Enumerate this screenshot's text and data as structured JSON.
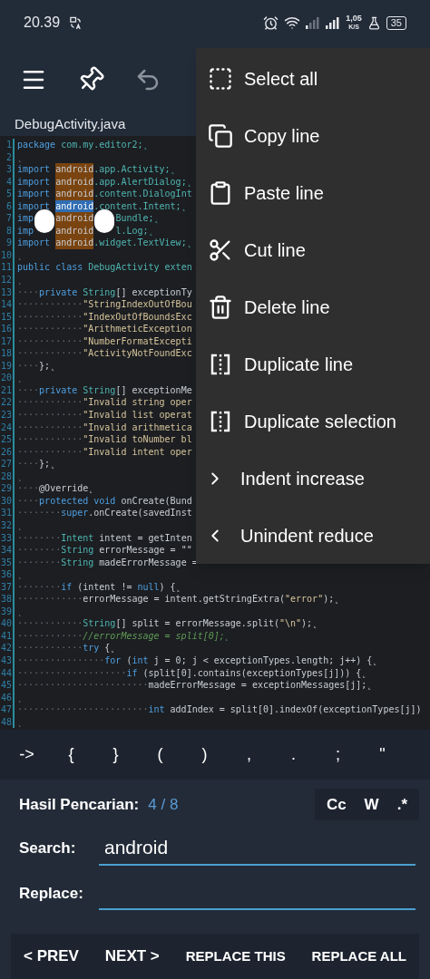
{
  "status_bar": {
    "time": "20.39",
    "speed_value": "1,05",
    "speed_unit": "K/S",
    "battery": "35"
  },
  "toolbar": [
    {
      "kind": "menu",
      "disabled": false
    },
    {
      "kind": "pin",
      "disabled": false
    },
    {
      "kind": "undo",
      "disabled": true
    }
  ],
  "file_tab": {
    "title": "DebugActivity.java"
  },
  "editor": {
    "lines": [
      {
        "number": "1",
        "segments": [
          {
            "text": "package",
            "kind": "kw"
          },
          {
            "text": " com.my.editor2;˛",
            "kind": "type"
          }
        ]
      },
      {
        "number": "2",
        "segments": [
          {
            "text": "˛",
            "kind": "ws"
          }
        ]
      },
      {
        "number": "3",
        "segments": [
          {
            "text": "import ",
            "kind": "kw"
          },
          {
            "text": "android",
            "kind": "match"
          },
          {
            "text": ".app.Activity;˛",
            "kind": "type"
          }
        ]
      },
      {
        "number": "4",
        "segments": [
          {
            "text": "import ",
            "kind": "kw"
          },
          {
            "text": "android",
            "kind": "match"
          },
          {
            "text": ".app.AlertDialog;˛",
            "kind": "type"
          }
        ]
      },
      {
        "number": "5",
        "segments": [
          {
            "text": "import ",
            "kind": "kw"
          },
          {
            "text": "android",
            "kind": "match"
          },
          {
            "text": ".content.DialogInt",
            "kind": "type"
          }
        ]
      },
      {
        "number": "6",
        "segments": [
          {
            "text": "import ",
            "kind": "kw"
          },
          {
            "text": "android",
            "kind": "current"
          },
          {
            "text": ".content.Intent;˛",
            "kind": "type"
          }
        ]
      },
      {
        "number": "7",
        "segments": [
          {
            "text": "imp",
            "kind": "kw"
          },
          {
            "kind": "blot"
          },
          {
            "text": "android",
            "kind": "match"
          },
          {
            "kind": "blot"
          },
          {
            "text": "Bundle;˛",
            "kind": "type"
          }
        ]
      },
      {
        "number": "8",
        "segments": [
          {
            "text": "imp",
            "kind": "kw"
          },
          {
            "kind": "blank"
          },
          {
            "text": "android",
            "kind": "match"
          },
          {
            "kind": "blank"
          },
          {
            "text": "l.Log;˛",
            "kind": "type"
          }
        ]
      },
      {
        "number": "9",
        "segments": [
          {
            "text": "import ",
            "kind": "kw"
          },
          {
            "text": "android",
            "kind": "match"
          },
          {
            "text": ".widget.TextView;˛",
            "kind": "type"
          }
        ]
      },
      {
        "number": "10",
        "segments": [
          {
            "text": "˛",
            "kind": "ws"
          }
        ]
      },
      {
        "number": "11",
        "segments": [
          {
            "text": "public class ",
            "kind": "kw"
          },
          {
            "text": "DebugActivity exten",
            "kind": "type"
          }
        ]
      },
      {
        "number": "12",
        "segments": [
          {
            "text": "˛",
            "kind": "ws"
          }
        ]
      },
      {
        "number": "13",
        "segments": [
          {
            "text": "····",
            "kind": "ws"
          },
          {
            "text": "private ",
            "kind": "kw"
          },
          {
            "text": "String",
            "kind": "type"
          },
          {
            "text": "[] exceptionTy",
            "kind": "plain"
          }
        ]
      },
      {
        "number": "14",
        "segments": [
          {
            "text": "············",
            "kind": "ws"
          },
          {
            "text": "\"StringIndexOutOfBou",
            "kind": "str"
          }
        ]
      },
      {
        "number": "15",
        "segments": [
          {
            "text": "············",
            "kind": "ws"
          },
          {
            "text": "\"IndexOutOfBoundsExc",
            "kind": "str"
          }
        ]
      },
      {
        "number": "16",
        "segments": [
          {
            "text": "············",
            "kind": "ws"
          },
          {
            "text": "\"ArithmeticException",
            "kind": "str"
          }
        ]
      },
      {
        "number": "17",
        "segments": [
          {
            "text": "············",
            "kind": "ws"
          },
          {
            "text": "\"NumberFormatExcepti",
            "kind": "str"
          }
        ]
      },
      {
        "number": "18",
        "segments": [
          {
            "text": "············",
            "kind": "ws"
          },
          {
            "text": "\"ActivityNotFoundExc",
            "kind": "str"
          }
        ]
      },
      {
        "number": "19",
        "segments": [
          {
            "text": "····",
            "kind": "ws"
          },
          {
            "text": "};˛",
            "kind": "plain"
          }
        ]
      },
      {
        "number": "20",
        "segments": [
          {
            "text": "˛",
            "kind": "ws"
          }
        ]
      },
      {
        "number": "21",
        "segments": [
          {
            "text": "····",
            "kind": "ws"
          },
          {
            "text": "private ",
            "kind": "kw"
          },
          {
            "text": "String",
            "kind": "type"
          },
          {
            "text": "[] exceptionMe",
            "kind": "plain"
          }
        ]
      },
      {
        "number": "22",
        "segments": [
          {
            "text": "············",
            "kind": "ws"
          },
          {
            "text": "\"Invalid string oper",
            "kind": "str"
          }
        ]
      },
      {
        "number": "23",
        "segments": [
          {
            "text": "············",
            "kind": "ws"
          },
          {
            "text": "\"Invalid list operat",
            "kind": "str"
          }
        ]
      },
      {
        "number": "24",
        "segments": [
          {
            "text": "············",
            "kind": "ws"
          },
          {
            "text": "\"Invalid arithmetica",
            "kind": "str"
          }
        ]
      },
      {
        "number": "25",
        "segments": [
          {
            "text": "············",
            "kind": "ws"
          },
          {
            "text": "\"Invalid toNumber bl",
            "kind": "str"
          }
        ]
      },
      {
        "number": "26",
        "segments": [
          {
            "text": "············",
            "kind": "ws"
          },
          {
            "text": "\"Invalid intent oper",
            "kind": "str"
          }
        ]
      },
      {
        "number": "27",
        "segments": [
          {
            "text": "····",
            "kind": "ws"
          },
          {
            "text": "};˛",
            "kind": "plain"
          }
        ]
      },
      {
        "number": "28",
        "segments": [
          {
            "text": "˛",
            "kind": "ws"
          }
        ]
      },
      {
        "number": "29",
        "segments": [
          {
            "text": "····",
            "kind": "ws"
          },
          {
            "text": "@Override˛",
            "kind": "plain"
          }
        ]
      },
      {
        "number": "30",
        "segments": [
          {
            "text": "····",
            "kind": "ws"
          },
          {
            "text": "protected void ",
            "kind": "kw"
          },
          {
            "text": "onCreate(Bund",
            "kind": "plain"
          }
        ]
      },
      {
        "number": "31",
        "segments": [
          {
            "text": "········",
            "kind": "ws"
          },
          {
            "text": "super",
            "kind": "kw"
          },
          {
            "text": ".onCreate(savedInst",
            "kind": "plain"
          }
        ]
      },
      {
        "number": "32",
        "segments": [
          {
            "text": "˛",
            "kind": "ws"
          }
        ]
      },
      {
        "number": "33",
        "segments": [
          {
            "text": "········",
            "kind": "ws"
          },
          {
            "text": "Intent",
            "kind": "type"
          },
          {
            "text": " intent = getInten",
            "kind": "plain"
          }
        ]
      },
      {
        "number": "34",
        "segments": [
          {
            "text": "········",
            "kind": "ws"
          },
          {
            "text": "String",
            "kind": "type"
          },
          {
            "text": " errorMessage = \"\"",
            "kind": "plain"
          }
        ]
      },
      {
        "number": "35",
        "segments": [
          {
            "text": "········",
            "kind": "ws"
          },
          {
            "text": "String",
            "kind": "type"
          },
          {
            "text": " madeErrorMessage =",
            "kind": "plain"
          }
        ]
      },
      {
        "number": "36",
        "segments": [
          {
            "text": "˛",
            "kind": "ws"
          }
        ]
      },
      {
        "number": "37",
        "segments": [
          {
            "text": "········",
            "kind": "ws"
          },
          {
            "text": "if ",
            "kind": "kw"
          },
          {
            "text": "(intent != ",
            "kind": "plain"
          },
          {
            "text": "null",
            "kind": "kw"
          },
          {
            "text": ") {˛",
            "kind": "plain"
          }
        ]
      },
      {
        "number": "38",
        "segments": [
          {
            "text": "············",
            "kind": "ws"
          },
          {
            "text": "errorMessage = intent.getStringExtra(",
            "kind": "plain"
          },
          {
            "text": "\"error\"",
            "kind": "str"
          },
          {
            "text": ");˛",
            "kind": "plain"
          }
        ]
      },
      {
        "number": "39",
        "segments": [
          {
            "text": "˛",
            "kind": "ws"
          }
        ]
      },
      {
        "number": "40",
        "segments": [
          {
            "text": "············",
            "kind": "ws"
          },
          {
            "text": "String",
            "kind": "type"
          },
          {
            "text": "[] split = errorMessage.split(",
            "kind": "plain"
          },
          {
            "text": "\"\\n\"",
            "kind": "str"
          },
          {
            "text": ");˛",
            "kind": "plain"
          }
        ]
      },
      {
        "number": "41",
        "segments": [
          {
            "text": "············",
            "kind": "ws"
          },
          {
            "text": "//errorMessage = split[0];˛",
            "kind": "cmt"
          }
        ]
      },
      {
        "number": "42",
        "segments": [
          {
            "text": "············",
            "kind": "ws"
          },
          {
            "text": "try ",
            "kind": "kw"
          },
          {
            "text": "{˛",
            "kind": "plain"
          }
        ]
      },
      {
        "number": "43",
        "segments": [
          {
            "text": "················",
            "kind": "ws"
          },
          {
            "text": "for ",
            "kind": "kw"
          },
          {
            "text": "(",
            "kind": "plain"
          },
          {
            "text": "int",
            "kind": "kw"
          },
          {
            "text": " j = 0; j < exceptionTypes.length; j++) {˛",
            "kind": "plain"
          }
        ]
      },
      {
        "number": "44",
        "segments": [
          {
            "text": "····················",
            "kind": "ws"
          },
          {
            "text": "if ",
            "kind": "kw"
          },
          {
            "text": "(split[0].contains(exceptionTypes[j])) {˛",
            "kind": "plain"
          }
        ]
      },
      {
        "number": "45",
        "segments": [
          {
            "text": "························",
            "kind": "ws"
          },
          {
            "text": "madeErrorMessage = exceptionMessages[j];˛",
            "kind": "plain"
          }
        ]
      },
      {
        "number": "46",
        "segments": [
          {
            "text": "˛",
            "kind": "ws"
          }
        ]
      },
      {
        "number": "47",
        "segments": [
          {
            "text": "························",
            "kind": "ws"
          },
          {
            "text": "int",
            "kind": "kw"
          },
          {
            "text": " addIndex = split[0].indexOf(exceptionTypes[j])",
            "kind": "plain"
          }
        ]
      },
      {
        "number": "48",
        "segments": [
          {
            "text": "˛",
            "kind": "ws"
          }
        ]
      }
    ]
  },
  "context_menu": [
    {
      "label": "Select all",
      "kind": "select"
    },
    {
      "label": "Copy line",
      "kind": "copy"
    },
    {
      "label": "Paste line",
      "kind": "paste"
    },
    {
      "label": "Cut line",
      "kind": "cut"
    },
    {
      "label": "Delete line",
      "kind": "delete"
    },
    {
      "label": "Duplicate line",
      "kind": "duplicate"
    },
    {
      "label": "Duplicate selection",
      "kind": "duplicate"
    },
    {
      "label": "Indent increase",
      "kind": "indent"
    },
    {
      "label": "Unindent reduce",
      "kind": "unindent"
    }
  ],
  "symbol_bar": [
    "->",
    "{",
    "}",
    "(",
    ")",
    ",",
    ".",
    ";",
    "\""
  ],
  "search_panel": {
    "results_label": "Hasil Pencarian:",
    "results_count": "4 / 8",
    "options": [
      "Cc",
      "W",
      ".*"
    ],
    "search_label": "Search:",
    "search_value": "android",
    "replace_label": "Replace:",
    "buttons": [
      "< PREV",
      "NEXT >",
      "REPLACE THIS",
      "REPLACE ALL"
    ]
  }
}
